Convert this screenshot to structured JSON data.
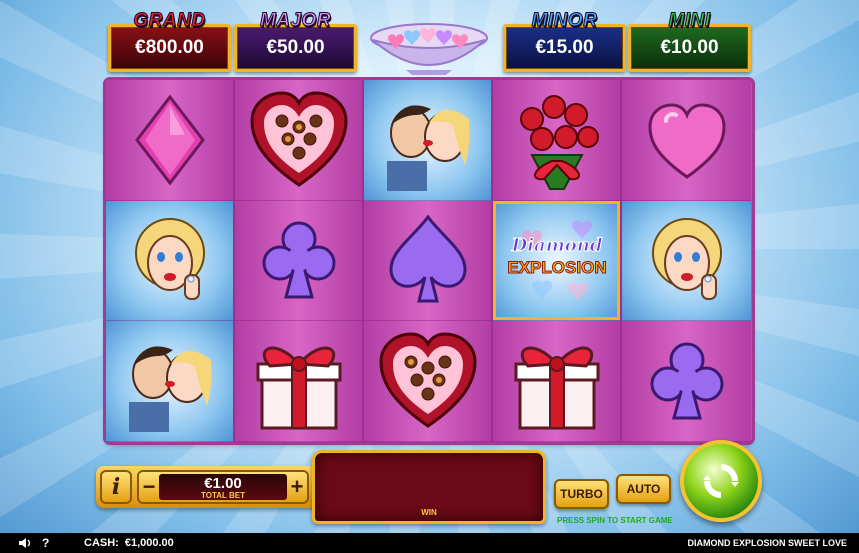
{
  "jackpots": {
    "grand": {
      "label": "GRAND",
      "value": "€800.00",
      "color": "#e8242a"
    },
    "major": {
      "label": "MAJOR",
      "value": "€50.00",
      "color": "#e08ef0"
    },
    "minor": {
      "label": "MINOR",
      "value": "€15.00",
      "color": "#4aa8ff"
    },
    "mini": {
      "label": "MINI",
      "value": "€10.00",
      "color": "#3ccf3c"
    }
  },
  "reels": [
    [
      "pink-diamond-suit",
      "blonde-woman-ring",
      "couple-kissing"
    ],
    [
      "chocolate-heart-box",
      "purple-club-suit",
      "gift-box"
    ],
    [
      "couple-kissing",
      "purple-spade-suit",
      "chocolate-heart-box"
    ],
    [
      "rose-bouquet",
      "diamond-explosion-scatter",
      "gift-box"
    ],
    [
      "pink-heart-suit",
      "blonde-woman-ring",
      "purple-club-suit"
    ]
  ],
  "scatter": {
    "line1": "Diamond",
    "line2": "EXPLOSION"
  },
  "controls": {
    "info_label": "i",
    "minus_label": "−",
    "plus_label": "+",
    "bet_value": "€1.00",
    "bet_label": "TOTAL BET",
    "win_label": "WIN",
    "turbo_label": "TURBO",
    "auto_label": "AUTO",
    "spin_hint": "PRESS SPIN TO START GAME"
  },
  "status": {
    "help_label": "?",
    "cash_label": "CASH:",
    "cash_value": "€1,000.00",
    "game_name": "DIAMOND EXPLOSION SWEET LOVE"
  }
}
